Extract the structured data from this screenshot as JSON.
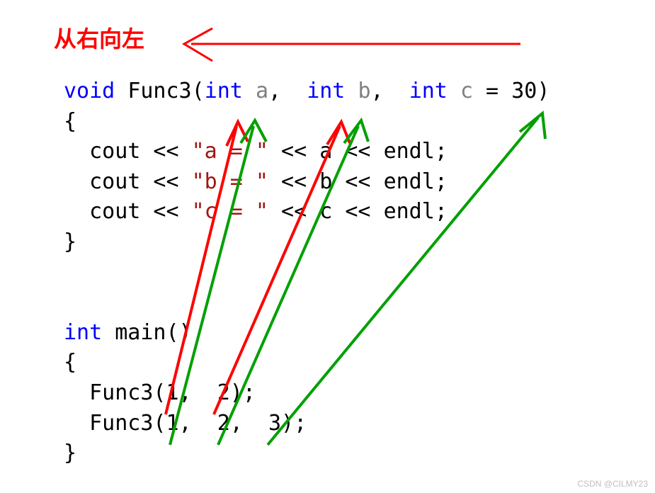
{
  "annotation_title": "从右向左",
  "code": {
    "line1": {
      "kw_void": "void",
      "sp1": " ",
      "fn": "Func3",
      "lp": "(",
      "kw_int1": "int",
      "sp2": " ",
      "p_a": "a",
      "comma1": ",",
      "sp3": "  ",
      "kw_int2": "int",
      "sp4": " ",
      "p_b": "b",
      "comma2": ",",
      "sp5": "  ",
      "kw_int3": "int",
      "sp6": " ",
      "p_c": "c",
      "eq": " = ",
      "val": "30",
      "rp": ")"
    },
    "line2": "{",
    "line3": {
      "indent": "  ",
      "cout": "cout",
      "op1": " << ",
      "str": "\"a = \"",
      "op2": " << ",
      "var": "a",
      "op3": " << ",
      "endl": "endl",
      "semi": ";"
    },
    "line4": {
      "indent": "  ",
      "cout": "cout",
      "op1": " << ",
      "str": "\"b = \"",
      "op2": " << ",
      "var": "b",
      "op3": " << ",
      "endl": "endl",
      "semi": ";"
    },
    "line5": {
      "indent": "  ",
      "cout": "cout",
      "op1": " << ",
      "str": "\"c = \"",
      "op2": " << ",
      "var": "c",
      "op3": " << ",
      "endl": "endl",
      "semi": ";"
    },
    "line6": "}",
    "line7": "",
    "line8": {
      "kw_int": "int",
      "sp": " ",
      "fn": "main",
      "parens": "()"
    },
    "line9": "{",
    "line10": {
      "indent": "  ",
      "call": "Func3(1,  2);"
    },
    "line11": {
      "indent": "  ",
      "call": "Func3(1,  2,  3);"
    },
    "line12": "}"
  },
  "watermark": "CSDN @CILMY23",
  "colors": {
    "red": "#ff0000",
    "green": "#00a000",
    "keyword_blue": "#0000ff",
    "gray_param": "#808080",
    "string_brown": "#a31515"
  }
}
